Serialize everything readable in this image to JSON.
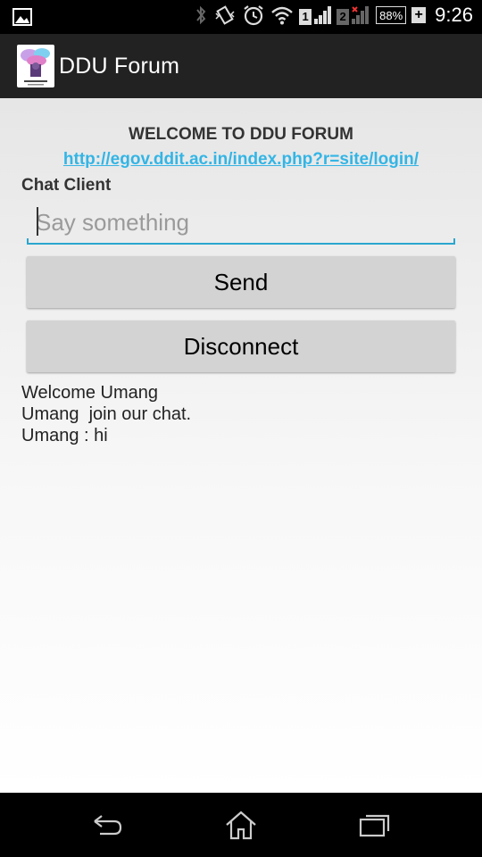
{
  "status_bar": {
    "time": "9:26",
    "battery_percent": "88%",
    "sim1": "1",
    "sim2": "2",
    "icons": [
      "gallery-icon",
      "bluetooth-icon",
      "vibrate-icon",
      "alarm-icon",
      "wifi-icon",
      "signal-icon",
      "battery-icon"
    ]
  },
  "action_bar": {
    "title": "DDU Forum",
    "logo": "ddu-forum-logo"
  },
  "main": {
    "welcome_text": "WELCOME TO DDU FORUM",
    "link_text": "http://egov.ddit.ac.in/index.php?r=site/login/",
    "chat_label": "Chat Client",
    "input": {
      "placeholder": "Say something",
      "value": ""
    },
    "send_label": "Send",
    "disconnect_label": "Disconnect",
    "messages": [
      "Welcome Umang",
      "Umang  join our chat.",
      "Umang : hi"
    ]
  },
  "nav_bar": {
    "icons": [
      "back-icon",
      "home-icon",
      "recent-apps-icon"
    ]
  },
  "colors": {
    "accent": "#33b5e5",
    "action_bar": "#222222",
    "button": "#d3d3d3"
  }
}
